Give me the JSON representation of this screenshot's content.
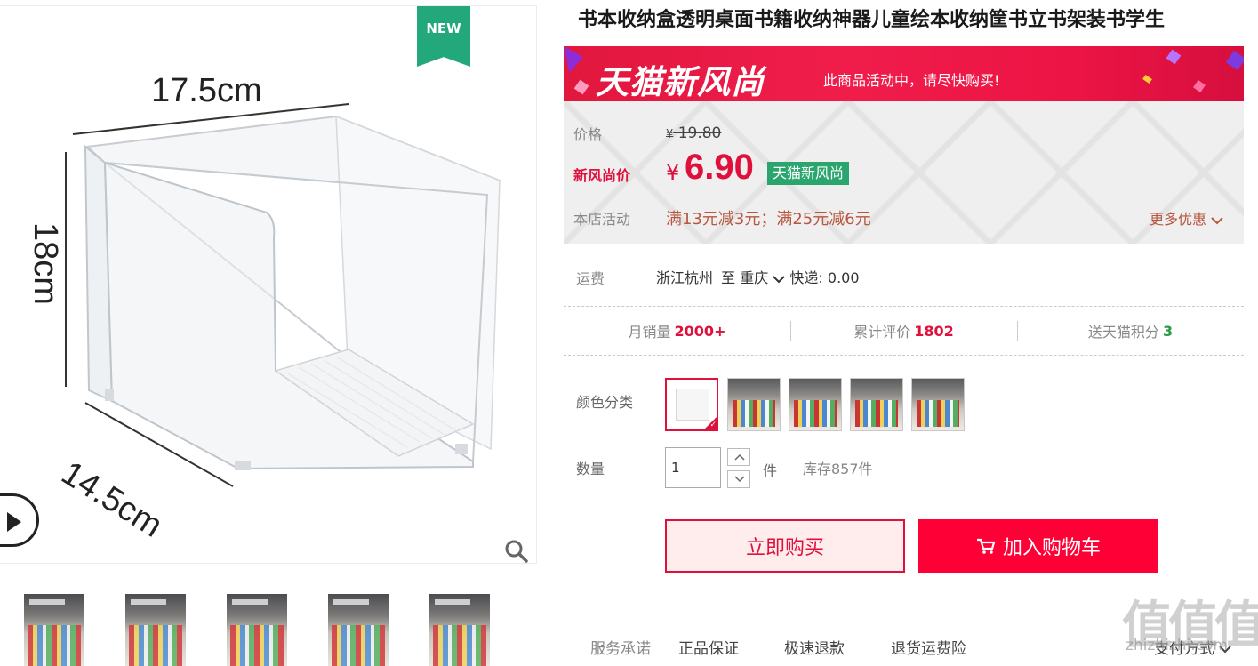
{
  "gallery": {
    "badge": "NEW",
    "dimensions": {
      "width": "17.5cm",
      "height": "18cm",
      "depth": "14.5cm"
    },
    "thumbnails": [
      "thumb-1",
      "thumb-2",
      "thumb-3",
      "thumb-4",
      "thumb-5"
    ]
  },
  "product": {
    "title": "书本收纳盒透明桌面书籍收纳神器儿童绘本收纳筐书立书架装书学生"
  },
  "banner": {
    "brand": "天猫新风尚",
    "message": "此商品活动中，请尽快购买!"
  },
  "pricing": {
    "price_label": "价格",
    "original_currency": "¥",
    "original_price": "19.80",
    "sale_label": "新风尚价",
    "sale_currency": "¥",
    "sale_price": "6.90",
    "sale_badge": "天猫新风尚",
    "promo_label": "本店活动",
    "promo_detail": "满13元减3元；满25元减6元",
    "more_deals": "更多优惠"
  },
  "shipping": {
    "label": "运费",
    "origin": "浙江杭州",
    "to": "至",
    "destination": "重庆",
    "method": "快递: 0.00"
  },
  "stats": {
    "monthly_sales_label": "月销量",
    "monthly_sales": "2000+",
    "reviews_label": "累计评价",
    "reviews": "1802",
    "points_label": "送天猫积分",
    "points": "3"
  },
  "options": {
    "color_label": "颜色分类",
    "swatches": [
      "clear-box",
      "books-1",
      "books-2",
      "books-3",
      "books-4"
    ],
    "selected_index": 0
  },
  "quantity": {
    "label": "数量",
    "value": "1",
    "unit": "件",
    "stock": "库存857件"
  },
  "actions": {
    "buy_now": "立即购买",
    "add_to_cart": "加入购物车"
  },
  "service": {
    "label": "服务承诺",
    "items": [
      "正品保证",
      "极速退款",
      "退货运费险"
    ],
    "payment": "支付方式"
  },
  "watermark": {
    "mark": "值值值",
    "site": "zhizhizhi.com"
  },
  "colors": {
    "accent": "#e0103c",
    "cart_button": "#ff0036",
    "badge_green": "#2aa56e",
    "promo_text": "#b8573f"
  }
}
